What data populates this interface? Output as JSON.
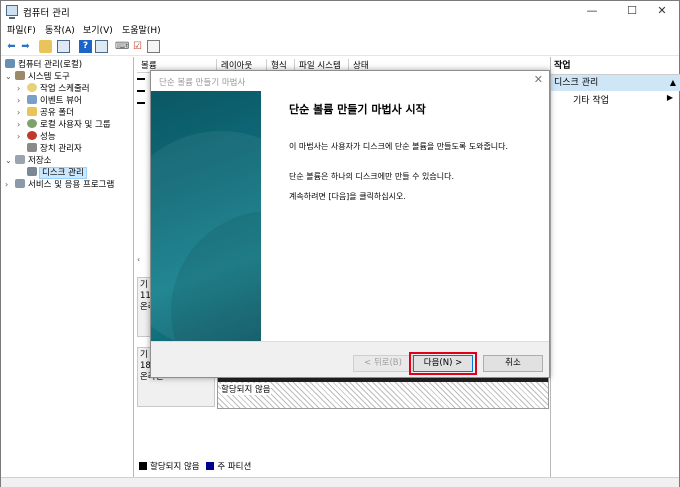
{
  "window": {
    "title": "컴퓨터 관리"
  },
  "window_controls": {
    "minimize": "—",
    "maximize": "☐",
    "close": "✕"
  },
  "menu": [
    "파일(F)",
    "동작(A)",
    "보기(V)",
    "도움말(H)"
  ],
  "tree": {
    "root": "컴퓨터 관리(로컬)",
    "system_tools": "시스템 도구",
    "task_scheduler": "작업 스케줄러",
    "event_viewer": "이벤트 뷰어",
    "shared_folders": "공유 폴더",
    "local_users": "로컬 사용자 및 그룹",
    "performance": "성능",
    "device_manager": "장치 관리자",
    "storage": "저장소",
    "disk_management": "디스크 관리",
    "services": "서비스 및 응용 프로그램"
  },
  "columns": [
    "볼륨",
    "레이아웃",
    "형식",
    "파일 시스템",
    "상태"
  ],
  "disks": {
    "disk0_line1": "기",
    "disk0_line2": "11",
    "disk0_line3": "온라",
    "disk1_line1": "기",
    "disk1_line2": "18",
    "disk1_line3": "온라인",
    "unallocated": "할당되지 않음"
  },
  "legend": {
    "unallocated": "할당되지 않음",
    "primary": "주 파티션"
  },
  "actions": {
    "title": "작업",
    "section": "디스크 관리",
    "more": "기타 작업"
  },
  "dialog": {
    "title": "단순 볼륨 만들기 마법사",
    "heading": "단순 볼륨 만들기 마법사 시작",
    "para1": "이 마법사는 사용자가 디스크에 단순 볼륨을 만들도록 도와줍니다.",
    "para2": "단순 볼륨은 하나의 디스크에만 만들 수 있습니다.",
    "para3": "계속하려면 [다음]을 클릭하십시오.",
    "back": "< 뒤로(B)",
    "next": "다음(N) >",
    "cancel": "취소"
  },
  "colors": {
    "selection": "#cce8ff",
    "action_header": "#cfe6f6",
    "highlight": "#e0001a",
    "wizard_panel": "#0f6f7d",
    "primary_partition": "#00008b"
  }
}
